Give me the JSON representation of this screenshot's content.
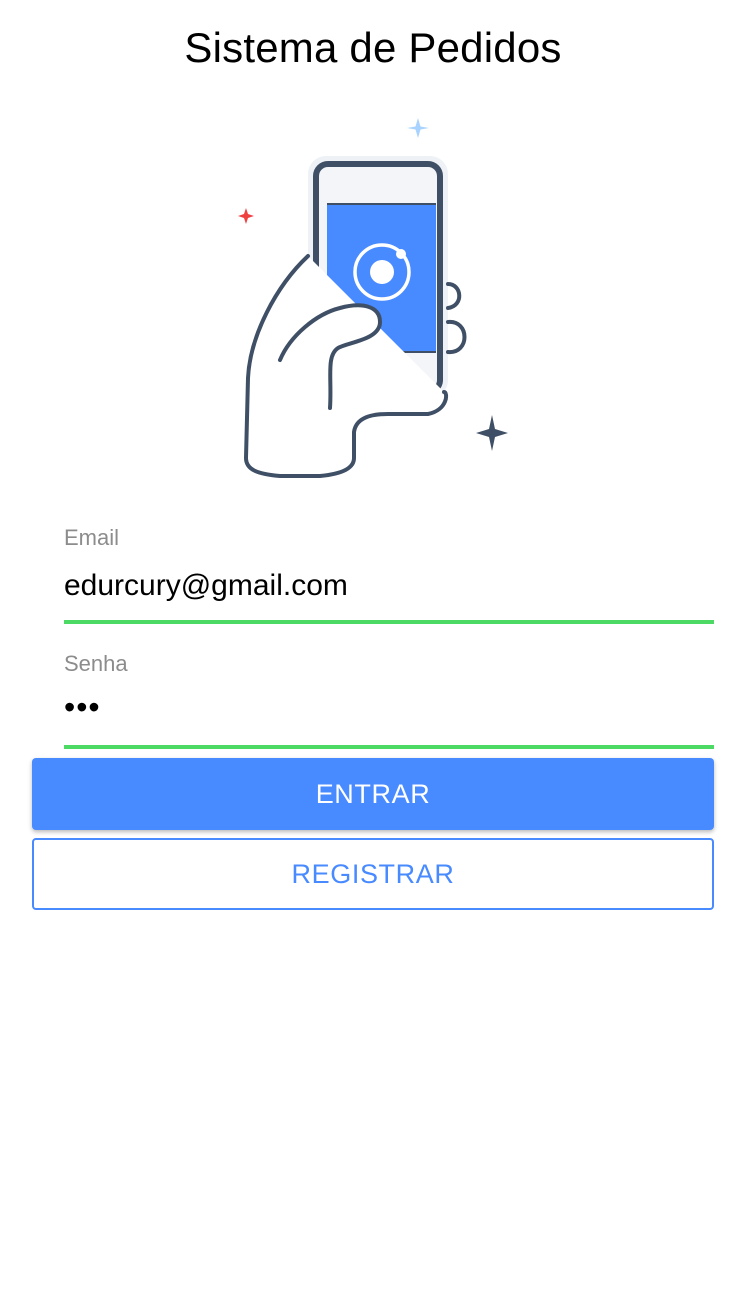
{
  "header": {
    "title": "Sistema de Pedidos"
  },
  "hero": {
    "icon": "hand-holding-phone-illustration"
  },
  "form": {
    "email": {
      "label": "Email",
      "value": "edurcury@gmail.com"
    },
    "senha": {
      "label": "Senha",
      "value": "•••"
    }
  },
  "actions": {
    "login_label": "ENTRAR",
    "register_label": "REGISTRAR"
  },
  "colors": {
    "primary": "#488aff",
    "valid_underline": "#4cd964",
    "label": "#8c8c8c"
  }
}
